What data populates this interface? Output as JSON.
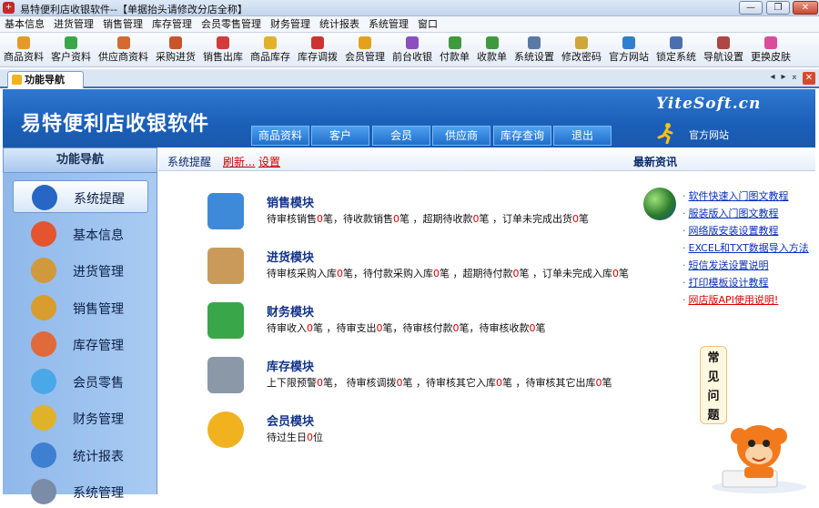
{
  "window": {
    "title": "易特便利店收银软件--【单据抬头请修改分店全称】",
    "app_icon_glyph": "+",
    "minimize_glyph": "—",
    "maximize_glyph": "❐",
    "close_glyph": "✕"
  },
  "menu": [
    "基本信息",
    "进货管理",
    "销售管理",
    "库存管理",
    "会员零售管理",
    "财务管理",
    "统计报表",
    "系统管理",
    "窗口"
  ],
  "toolbar": [
    {
      "label": "商品资料",
      "icon": "goods-icon",
      "color": "#e39a2b"
    },
    {
      "label": "客户资料",
      "icon": "customer-icon",
      "color": "#3aa64a"
    },
    {
      "label": "供应商资料",
      "icon": "supplier-icon",
      "color": "#d46a2f"
    },
    {
      "label": "采购进货",
      "icon": "purchase-icon",
      "color": "#c9542a"
    },
    {
      "label": "销售出库",
      "icon": "sales-out-icon",
      "color": "#d23b3b"
    },
    {
      "label": "商品库存",
      "icon": "stock-icon",
      "color": "#e0b22a"
    },
    {
      "label": "库存调拨",
      "icon": "transfer-icon",
      "color": "#cc3333"
    },
    {
      "label": "会员管理",
      "icon": "member-icon",
      "color": "#e3a21c"
    },
    {
      "label": "前台收银",
      "icon": "cashier-icon",
      "color": "#8b4fc0"
    },
    {
      "label": "付款单",
      "icon": "payment-icon",
      "color": "#3f9a3f"
    },
    {
      "label": "收款单",
      "icon": "receipt-icon",
      "color": "#3f9a3f"
    },
    {
      "label": "系统设置",
      "icon": "settings-icon",
      "color": "#5a7aa6"
    },
    {
      "label": "修改密码",
      "icon": "password-icon",
      "color": "#d0a63a"
    },
    {
      "label": "官方网站",
      "icon": "website-icon",
      "color": "#2f7fd1"
    },
    {
      "label": "锁定系统",
      "icon": "lock-icon",
      "color": "#4a6fb0"
    },
    {
      "label": "导航设置",
      "icon": "nav-settings-icon",
      "color": "#b04545"
    },
    {
      "label": "更换皮肤",
      "icon": "skin-icon",
      "color": "#d94d9a"
    }
  ],
  "tab": {
    "label": "功能导航",
    "prev": "◂",
    "next": "▸",
    "menu": "⌅",
    "close": "✕"
  },
  "banner": {
    "brand": "易特便利店收银软件",
    "site": "YiteSoft.cn",
    "nav": [
      "商品资料",
      "客户",
      "会员",
      "供应商",
      "库存查询",
      "退出"
    ],
    "official": "官方网站"
  },
  "sidebar": {
    "title": "功能导航",
    "items": [
      {
        "label": "系统提醒",
        "icon": "info-icon",
        "color": "#2766c4"
      },
      {
        "label": "基本信息",
        "icon": "cubes-icon",
        "color": "#e4542f"
      },
      {
        "label": "进货管理",
        "icon": "box-in-icon",
        "color": "#d09a3c"
      },
      {
        "label": "销售管理",
        "icon": "box-out-icon",
        "color": "#d89c2f"
      },
      {
        "label": "库存管理",
        "icon": "house-icon",
        "color": "#e06a3a"
      },
      {
        "label": "会员零售",
        "icon": "chat-icon",
        "color": "#4aa8e8"
      },
      {
        "label": "财务管理",
        "icon": "finance-icon",
        "color": "#e0b22a"
      },
      {
        "label": "统计报表",
        "icon": "chart-icon",
        "color": "#3f7fd1"
      },
      {
        "label": "系统管理",
        "icon": "gear-icon",
        "color": "#7a8ca8"
      }
    ]
  },
  "header": {
    "label": "系统提醒",
    "refresh": "刷新...",
    "settings": "设置",
    "news_title": "最新资讯"
  },
  "modules": [
    {
      "title": "销售模块",
      "icon": "sales-module-icon",
      "color": "#3f8ad8",
      "parts": [
        "待审核销售",
        "0",
        "笔，待收款销售",
        "0",
        "笔 ，超期待收款",
        "0",
        "笔 ，订单未完成出货",
        "0",
        "笔"
      ]
    },
    {
      "title": "进货模块",
      "icon": "purchase-module-icon",
      "color": "#c99a5a",
      "parts": [
        "待审核采购入库",
        "0",
        "笔，待付款采购入库",
        "0",
        "笔 ，超期待付款",
        "0",
        "笔 ，订单未完成入库",
        "0",
        "笔"
      ]
    },
    {
      "title": "财务模块",
      "icon": "finance-module-icon",
      "color": "#3aa64a",
      "parts": [
        "待审收入",
        "0",
        "笔 ，待审支出",
        "0",
        "笔，待审核付款",
        "0",
        "笔，待审核收款",
        "0",
        "笔"
      ]
    },
    {
      "title": "库存模块",
      "icon": "stock-module-icon",
      "color": "#8a98a8",
      "parts": [
        "上下限预警",
        "0",
        "笔， 待审核调拨",
        "0",
        "笔 ，待审核其它入库",
        "0",
        "笔 ，待审核其它出库",
        "0",
        "笔"
      ]
    },
    {
      "title": "会员模块",
      "icon": "member-module-icon",
      "color": "#f0b21e",
      "parts": [
        "待过生日",
        "0",
        "位"
      ]
    }
  ],
  "news": [
    {
      "text": "软件快速入门图文教程",
      "highlight": false
    },
    {
      "text": "服装版入门图文教程",
      "highlight": false
    },
    {
      "text": "网络版安装设置教程",
      "highlight": false
    },
    {
      "text": "EXCEL和TXT数据导入方法",
      "highlight": false
    },
    {
      "text": "短信发送设置说明",
      "highlight": false
    },
    {
      "text": "打印模板设计教程",
      "highlight": false
    },
    {
      "text": "网店版API使用说明!",
      "highlight": true
    }
  ],
  "news_icon": "download-globe-icon",
  "faq": [
    "常",
    "见",
    "问",
    "题"
  ]
}
